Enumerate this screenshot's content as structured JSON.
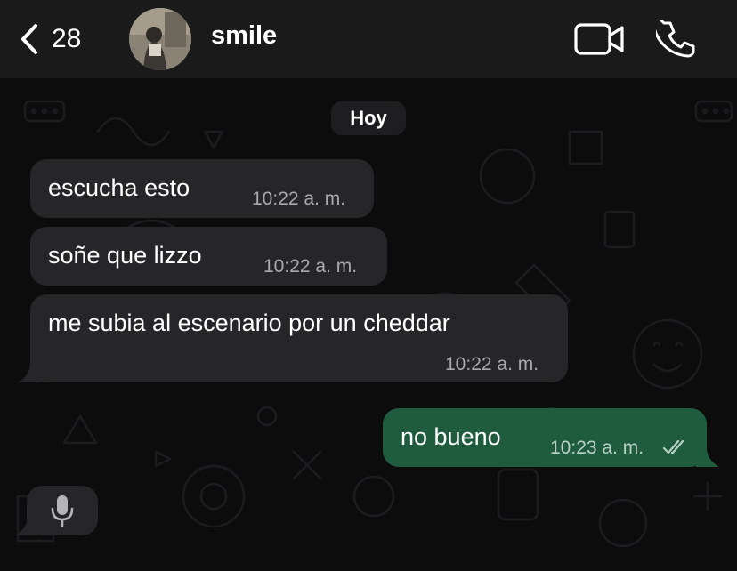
{
  "header": {
    "back_count": "28",
    "contact_name": "smile"
  },
  "chat": {
    "day_label": "Hoy",
    "messages": [
      {
        "text": "escucha esto",
        "time": "10:22 a. m.",
        "direction": "in"
      },
      {
        "text": "soñe que lizzo",
        "time": "10:22 a. m.",
        "direction": "in"
      },
      {
        "text": "me subia al escenario por un cheddar",
        "time": "10:22 a. m.",
        "direction": "in"
      },
      {
        "text": "no bueno",
        "time": "10:23 a. m.",
        "direction": "out",
        "status": "read"
      }
    ]
  },
  "icons": {
    "back": "chevron-left-icon",
    "video": "video-camera-icon",
    "call": "phone-icon",
    "mic": "microphone-icon",
    "read": "double-check-icon"
  },
  "colors": {
    "background": "#0c0c0d",
    "incoming_bubble": "#262628",
    "outgoing_bubble": "#1f5c3d",
    "timestamp": "#a9a9ad"
  }
}
